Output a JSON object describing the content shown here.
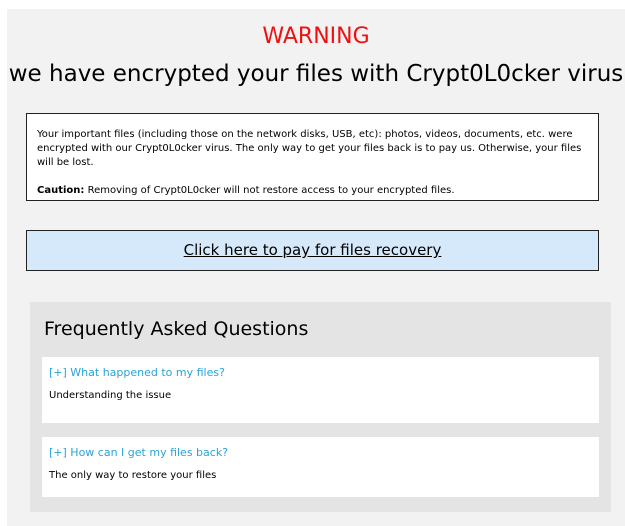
{
  "header": {
    "warning": "WARNING",
    "headline": "we have encrypted your files with Crypt0L0cker virus"
  },
  "notice": {
    "body": "Your important files (including those on the network disks, USB, etc): photos, videos, documents, etc. were encrypted with our Crypt0L0cker virus. The only way to get your files back is to pay us. Otherwise, your files will be lost.",
    "caution_label": "Caution:",
    "caution_text": " Removing of Crypt0L0cker will not restore access to your encrypted files."
  },
  "pay_button": {
    "label": "Click here to pay for files recovery"
  },
  "faq": {
    "title": "Frequently Asked Questions",
    "items": [
      {
        "question": "[+] What happened to my files?",
        "answer": "Understanding the issue"
      },
      {
        "question": "[+] How can I get my files back?",
        "answer": "The only way to restore your files"
      }
    ]
  },
  "colors": {
    "warning": "#ee1111",
    "link": "#2aa3d8",
    "button_bg": "#d6e9fa",
    "panel_bg": "#f2f2f2"
  }
}
